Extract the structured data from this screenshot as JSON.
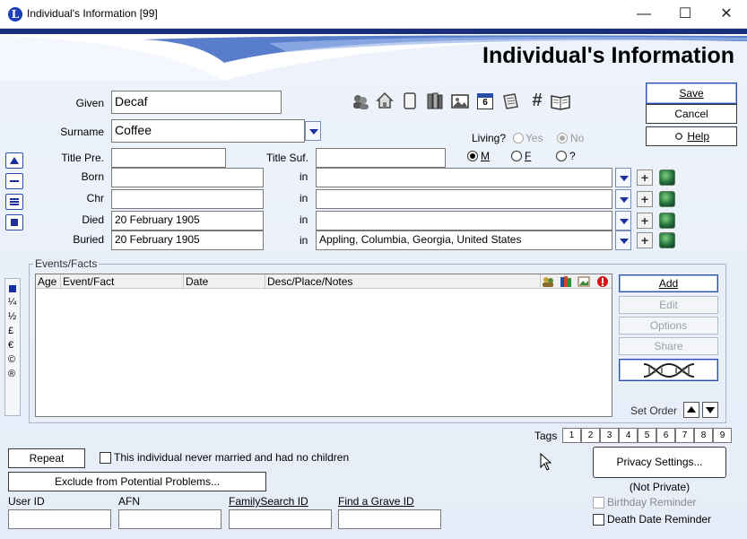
{
  "window": {
    "title": "Individual's Information  [99]",
    "logo_letter": "L"
  },
  "header": {
    "title": "Individual's Information"
  },
  "form": {
    "given_label": "Given",
    "given_value": "Decaf",
    "surname_label": "Surname",
    "surname_value": "Coffee",
    "title_pre_label": "Title Pre.",
    "title_pre_value": "",
    "title_suf_label": "Title Suf.",
    "title_suf_value": "",
    "events": [
      {
        "label": "Born",
        "date": "",
        "in_label": "in",
        "place": ""
      },
      {
        "label": "Chr",
        "date": "",
        "in_label": "in",
        "place": ""
      },
      {
        "label": "Died",
        "date": "20 February 1905",
        "in_label": "in",
        "place": ""
      },
      {
        "label": "Buried",
        "date": "20 February 1905",
        "in_label": "in",
        "place": "Appling, Columbia, Georgia, United States"
      }
    ]
  },
  "living": {
    "label": "Living?",
    "yes": "Yes",
    "no": "No",
    "selected": "No"
  },
  "sex": {
    "male": "M",
    "female": "F",
    "unknown": "?",
    "selected": "M"
  },
  "buttons": {
    "save": "Save",
    "cancel": "Cancel",
    "help": "Help",
    "add": "Add",
    "edit": "Edit",
    "options": "Options",
    "share": "Share",
    "repeat": "Repeat",
    "exclude": "Exclude from Potential Problems...",
    "privacy": "Privacy Settings..."
  },
  "events_facts": {
    "group_label": "Events/Facts",
    "columns": [
      "Age",
      "Event/Fact",
      "Date",
      "Desc/Place/Notes"
    ],
    "rows": []
  },
  "special_chars": [
    "¼",
    "½",
    "£",
    "€",
    "©",
    "®"
  ],
  "set_order_label": "Set Order",
  "tags": {
    "label": "Tags",
    "cells": [
      "1",
      "2",
      "3",
      "4",
      "5",
      "6",
      "7",
      "8",
      "9"
    ]
  },
  "never_married_label": "This individual never married and had no children",
  "ids": {
    "user_id_label": "User ID",
    "afn_label": "AFN",
    "familysearch_label": "FamilySearch ID",
    "findagrave_label": "Find a Grave ID",
    "user_id_value": "",
    "afn_value": "",
    "familysearch_value": "",
    "findagrave_value": ""
  },
  "privacy_status": "(Not Private)",
  "birthday_reminder_label": "Birthday Reminder",
  "death_date_reminder_label": "Death Date Reminder",
  "toolbar_icons": [
    "people-icon",
    "house-icon",
    "notes-icon",
    "books-icon",
    "picture-icon",
    "calendar-icon",
    "scroll-icon",
    "hash-icon",
    "book-open-icon"
  ],
  "calendar_day": "6",
  "hash_glyph": "#"
}
